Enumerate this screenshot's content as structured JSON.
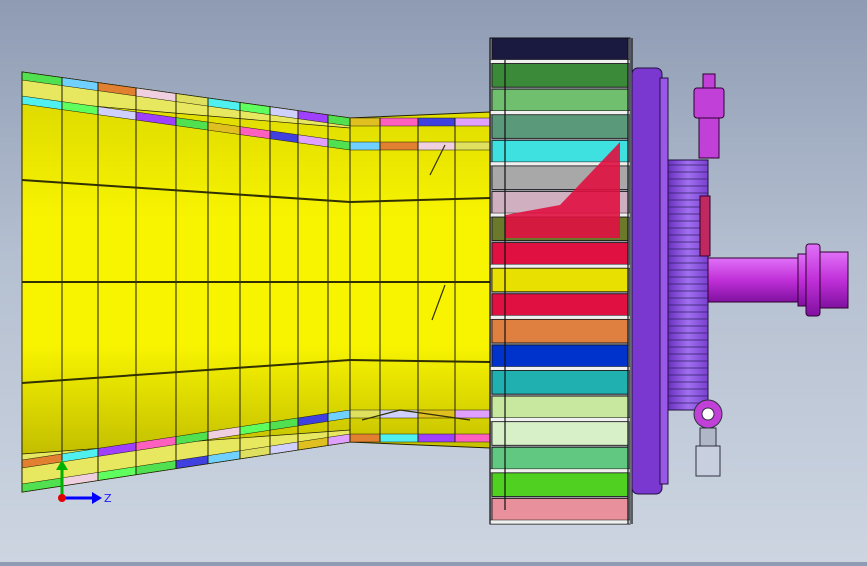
{
  "viewport": {
    "background_top": "#8e9bb3",
    "background_bottom": "#cdd5e1"
  },
  "triad": {
    "z_label": "Z",
    "x_color": "#e00000",
    "y_color": "#00b000",
    "z_color": "#0000ff"
  },
  "model": {
    "nozzle_color": "#f2f000",
    "nozzle_shade": "#b9b600",
    "fan_stripes": [
      "#1a1a40",
      "#3a8a3a",
      "#6fbf6f",
      "#5a9a7a",
      "#3ee0e0",
      "#a8a8a8",
      "#d0b0c0",
      "#6a7a2a",
      "#e01040",
      "#e8e000",
      "#e01040",
      "#e08040",
      "#0033cc",
      "#20b0b0",
      "#c8e8a0",
      "#d8f0c8",
      "#60c880",
      "#50d020",
      "#e8909c"
    ],
    "hub_color": "#8c4cd8",
    "shaft_color": "#c040e0"
  }
}
